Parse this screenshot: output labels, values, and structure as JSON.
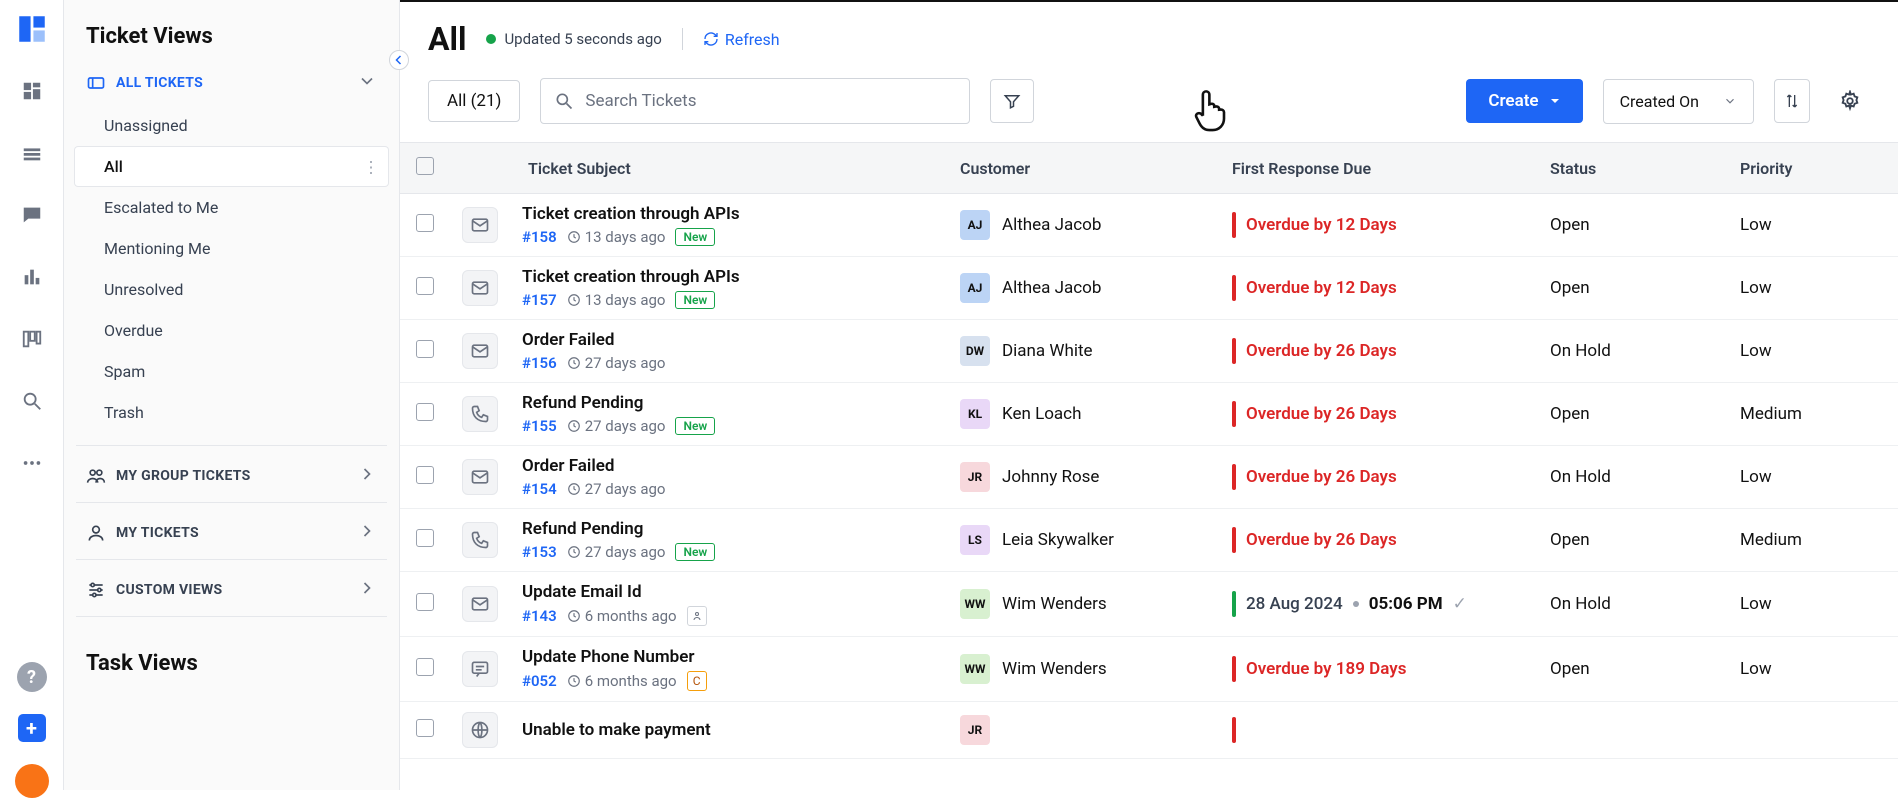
{
  "sidebar": {
    "heading": "Ticket Views",
    "groups": {
      "all_tickets": {
        "label": "ALL TICKETS",
        "items": [
          {
            "label": "Unassigned",
            "active": false
          },
          {
            "label": "All",
            "active": true
          },
          {
            "label": "Escalated to Me",
            "active": false
          },
          {
            "label": "Mentioning Me",
            "active": false
          },
          {
            "label": "Unresolved",
            "active": false
          },
          {
            "label": "Overdue",
            "active": false
          },
          {
            "label": "Spam",
            "active": false
          },
          {
            "label": "Trash",
            "active": false
          }
        ]
      },
      "my_group": {
        "label": "MY GROUP TICKETS"
      },
      "my_tickets": {
        "label": "MY TICKETS"
      },
      "custom": {
        "label": "CUSTOM VIEWS"
      }
    },
    "task_heading": "Task Views"
  },
  "header": {
    "title": "All",
    "updated": "Updated 5 seconds ago",
    "refresh": "Refresh"
  },
  "toolbar": {
    "chip": "All (21)",
    "search_placeholder": "Search Tickets",
    "create": "Create",
    "sort": "Created On"
  },
  "columns": [
    "Ticket Subject",
    "Customer",
    "First Response Due",
    "Status",
    "Priority"
  ],
  "badges": {
    "new": "New",
    "c": "C"
  },
  "avatar_colors": {
    "AJ": "#bcd4f5",
    "DW": "#d7e1ef",
    "KL": "#e9d8f7",
    "JR": "#f7d8dc",
    "LS": "#e9d8f7",
    "WW": "#d8f0d0",
    "JR2": "#f7d8dc"
  },
  "rows": [
    {
      "icon": "mail",
      "subject": "Ticket creation through APIs",
      "id": "#158",
      "ago": "13 days ago",
      "tag": "new",
      "cust_initials": "AJ",
      "cust": "Althea Jacob",
      "due": {
        "type": "overdue",
        "text": "Overdue by 12 Days"
      },
      "status": "Open",
      "priority": "Low"
    },
    {
      "icon": "mail",
      "subject": "Ticket creation through APIs",
      "id": "#157",
      "ago": "13 days ago",
      "tag": "new",
      "cust_initials": "AJ",
      "cust": "Althea Jacob",
      "due": {
        "type": "overdue",
        "text": "Overdue by 12 Days"
      },
      "status": "Open",
      "priority": "Low"
    },
    {
      "icon": "mail",
      "subject": "Order Failed",
      "id": "#156",
      "ago": "27 days ago",
      "tag": "",
      "cust_initials": "DW",
      "cust": "Diana White",
      "due": {
        "type": "overdue",
        "text": "Overdue by 26 Days"
      },
      "status": "On Hold",
      "priority": "Low"
    },
    {
      "icon": "phone",
      "subject": "Refund Pending",
      "id": "#155",
      "ago": "27 days ago",
      "tag": "new",
      "cust_initials": "KL",
      "cust": "Ken Loach",
      "due": {
        "type": "overdue",
        "text": "Overdue by 26 Days"
      },
      "status": "Open",
      "priority": "Medium"
    },
    {
      "icon": "mail",
      "subject": "Order Failed",
      "id": "#154",
      "ago": "27 days ago",
      "tag": "",
      "cust_initials": "JR",
      "cust": "Johnny Rose",
      "due": {
        "type": "overdue",
        "text": "Overdue by 26 Days"
      },
      "status": "On Hold",
      "priority": "Low"
    },
    {
      "icon": "phone",
      "subject": "Refund Pending",
      "id": "#153",
      "ago": "27 days ago",
      "tag": "new",
      "cust_initials": "LS",
      "cust": "Leia Skywalker",
      "due": {
        "type": "overdue",
        "text": "Overdue by 26 Days"
      },
      "status": "Open",
      "priority": "Medium"
    },
    {
      "icon": "mail",
      "subject": "Update Email Id",
      "id": "#143",
      "ago": "6 months ago",
      "tag": "person",
      "cust_initials": "WW",
      "cust": "Wim Wenders",
      "due": {
        "type": "date",
        "date": "28 Aug 2024",
        "time": "05:06 PM"
      },
      "status": "On Hold",
      "priority": "Low"
    },
    {
      "icon": "chat",
      "subject": "Update Phone Number",
      "id": "#052",
      "ago": "6 months ago",
      "tag": "c",
      "cust_initials": "WW",
      "cust": "Wim Wenders",
      "due": {
        "type": "overdue",
        "text": "Overdue by 189 Days"
      },
      "status": "Open",
      "priority": "Low"
    },
    {
      "icon": "globe",
      "subject": "Unable to make payment",
      "id": "",
      "ago": "",
      "tag": "",
      "cust_initials": "JR",
      "cust": "",
      "due": {
        "type": "overdue",
        "text": ""
      },
      "status": "",
      "priority": ""
    }
  ]
}
